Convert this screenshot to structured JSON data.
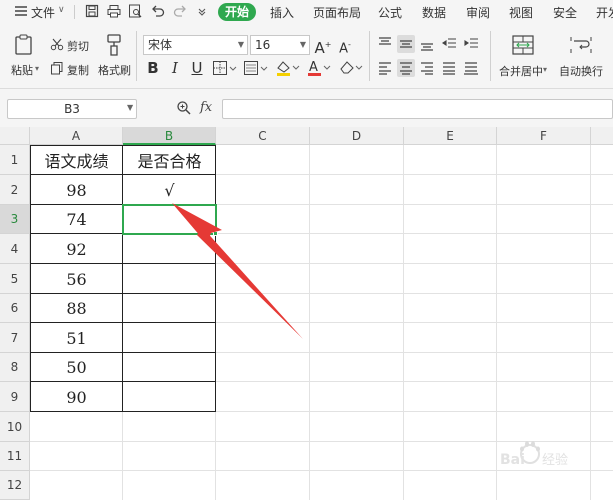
{
  "menu": {
    "file": "文件",
    "tabs": [
      "开始",
      "插入",
      "页面布局",
      "公式",
      "数据",
      "审阅",
      "视图",
      "安全",
      "开发"
    ]
  },
  "ribbon": {
    "paste": "粘贴",
    "cut": "剪切",
    "copy": "复制",
    "format_painter": "格式刷",
    "font_name": "宋体",
    "font_size": "16",
    "merge_center": "合并居中",
    "wrap_text": "自动换行"
  },
  "formula_bar": {
    "name_box": "B3",
    "fx": "fx",
    "value": ""
  },
  "sheet": {
    "columns": [
      "A",
      "B",
      "C",
      "D",
      "E",
      "F"
    ],
    "rows": [
      "1",
      "2",
      "3",
      "4",
      "5",
      "6",
      "7",
      "8",
      "9",
      "10",
      "11",
      "12"
    ],
    "header_a": "语文成绩",
    "header_b": "是否合格",
    "scores": [
      "98",
      "74",
      "92",
      "56",
      "88",
      "51",
      "50",
      "90"
    ],
    "check_b2": "√",
    "selected_cell": "B3"
  },
  "colors": {
    "accent_green": "#2fa84f",
    "arrow_red": "#e53935"
  },
  "watermark": "Baidu经验"
}
